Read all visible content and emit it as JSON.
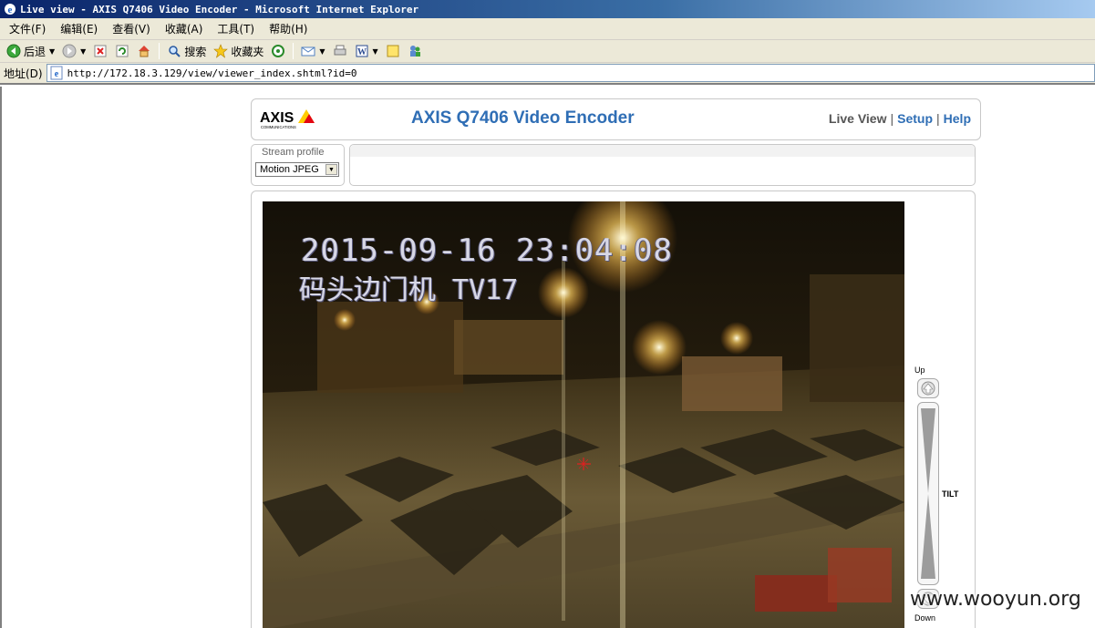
{
  "window": {
    "title": "Live view - AXIS Q7406 Video Encoder - Microsoft Internet Explorer"
  },
  "menubar": {
    "items": [
      "文件(F)",
      "编辑(E)",
      "查看(V)",
      "收藏(A)",
      "工具(T)",
      "帮助(H)"
    ]
  },
  "toolbar": {
    "back_label": "后退",
    "search_label": "搜索",
    "favorites_label": "收藏夹"
  },
  "addressbar": {
    "label": "地址(D)",
    "url": "http://172.18.3.129/view/viewer_index.shtml?id=0"
  },
  "page": {
    "logo_text": "AXIS",
    "logo_subtext": "COMMUNICATIONS",
    "product_title": "AXIS Q7406 Video Encoder",
    "nav": {
      "live_view": "Live View",
      "setup": "Setup",
      "help": "Help",
      "separator": "|"
    },
    "stream_profile": {
      "label": "Stream profile",
      "selected": "Motion JPEG"
    },
    "video": {
      "timestamp": "2015-09-16 23:04:08",
      "camera_name": "码头边门机  TV17"
    },
    "tilt": {
      "up_label": "Up",
      "down_label": "Down",
      "axis_label": "TILT"
    },
    "watermark": "www.wooyun.org"
  },
  "colors": {
    "title_blue": "#2f6eb5",
    "ie_titlebar": "#0a246a",
    "chrome_bg": "#ece9d8",
    "axis_yellow": "#ffcc00",
    "axis_red": "#e30613"
  }
}
